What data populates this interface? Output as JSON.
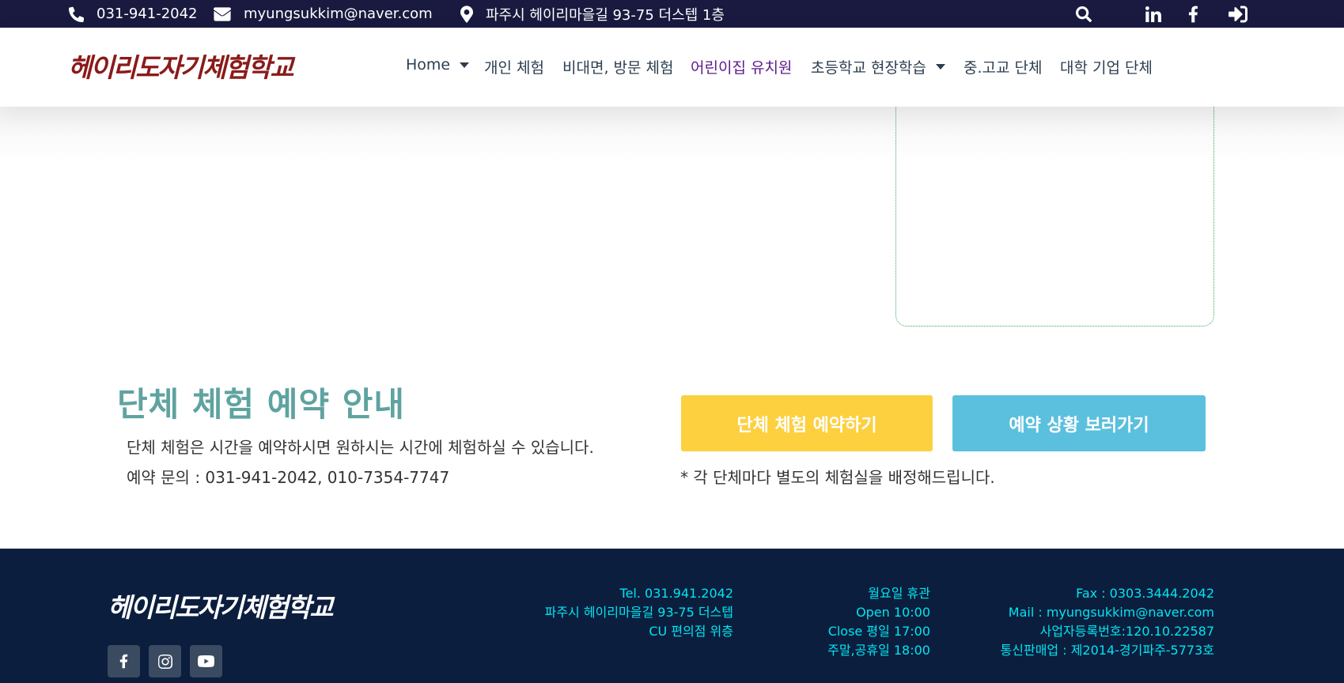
{
  "topbar": {
    "phone": "031-941-2042",
    "email": "myungsukkim@naver.com",
    "address": "파주시 헤이리마을길 93-75 더스텝 1층",
    "icons": [
      "phone-icon",
      "envelope-icon",
      "map-marker-icon",
      "search-icon",
      "linkedin-icon",
      "facebook-icon",
      "sign-in-icon"
    ]
  },
  "header": {
    "logo": "헤이리도자기체험학교",
    "nav": [
      {
        "label": "Home"
      },
      {
        "label": "개인 체험"
      },
      {
        "label": "비대면, 방문 체험"
      },
      {
        "label": "어린이집 유치원"
      },
      {
        "label": "초등학교 현장학습"
      },
      {
        "label": "중.고교 단체"
      },
      {
        "label": "대학 기업 단체"
      }
    ]
  },
  "reservation": {
    "title": "단체 체험 예약 안내",
    "line1": "단체 체험은 시간을 예약하시면 원하시는 시간에 체험하실 수 있습니다.",
    "line2": "예약 문의 : 031-941-2042, 010-7354-7747",
    "reserve_button": "단체 체험 예약하기",
    "status_button": "예약 상황 보러가기",
    "note": "* 각 단체마다 별도의 체험실을 배정해드립니다."
  },
  "footer": {
    "logo": "헤이리도자기체험학교",
    "col1": [
      "Tel. 031.941.2042",
      "파주시 헤이리마을길 93-75 더스텝",
      "CU 편의점 위층"
    ],
    "col2": [
      "월요일 휴관",
      "Open 10:00",
      "Close 평일 17:00",
      "주말,공휴일 18:00"
    ],
    "col3": [
      "Fax : 0303.3444.2042",
      "Mail : myungsukkim@naver.com",
      "사업자등록번호:120.10.22587",
      "통신판매업 : 제2014-경기파주-5773호"
    ],
    "social_icons": [
      "facebook-icon",
      "instagram-icon",
      "youtube-icon"
    ]
  },
  "colors": {
    "topbar_bg": "#1a1a40",
    "accent_teal": "#5fa3a0",
    "reserve_yellow": "#fdd040",
    "status_blue": "#5bc0de",
    "footer_bg": "#0c1e3e",
    "footer_text": "#00e5f0"
  }
}
